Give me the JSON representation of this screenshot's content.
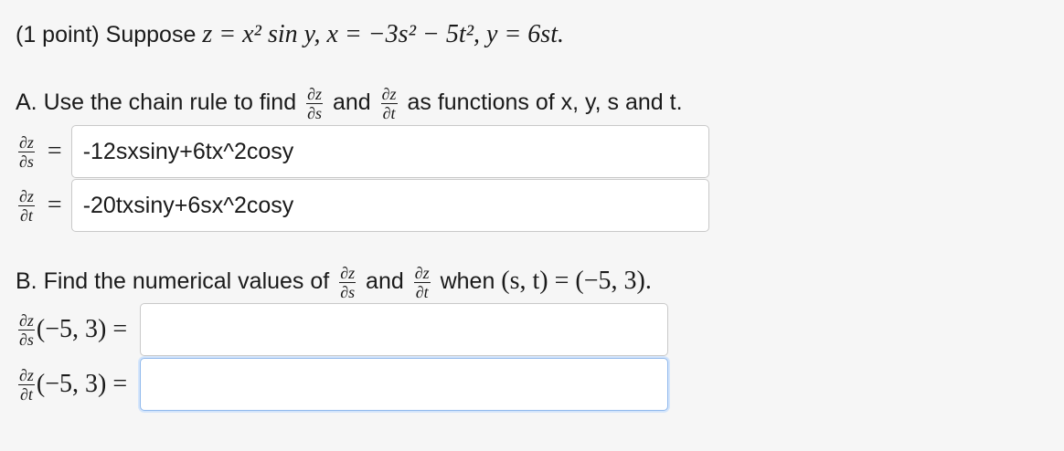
{
  "problem": {
    "points": "(1 point)",
    "suppose": "Suppose",
    "z_def": "z = x² sin y,",
    "x_def": "x = −3s² − 5t²,",
    "y_def": "y = 6st."
  },
  "part_a": {
    "prefix": "A. Use the chain rule to find",
    "and": "and",
    "suffix": "as functions of x, y, s and t.",
    "dz_ds_value": "-12sxsiny+6tx^2cosy",
    "dz_dt_value": "-20txsiny+6sx^2cosy"
  },
  "part_b": {
    "prefix": "B. Find the numerical values of",
    "and": "and",
    "when": "when",
    "point_condition": "(s, t) = (−5, 3).",
    "point_eval": "(−5, 3) =",
    "dz_ds_value": "",
    "dz_dt_value": ""
  },
  "derivatives": {
    "numerator": "∂z",
    "den_s": "∂s",
    "den_t": "∂t"
  },
  "colors": {
    "background": "#f6f6f6",
    "field_border": "#c9c9c9",
    "focus_border": "#8fb8ec"
  }
}
